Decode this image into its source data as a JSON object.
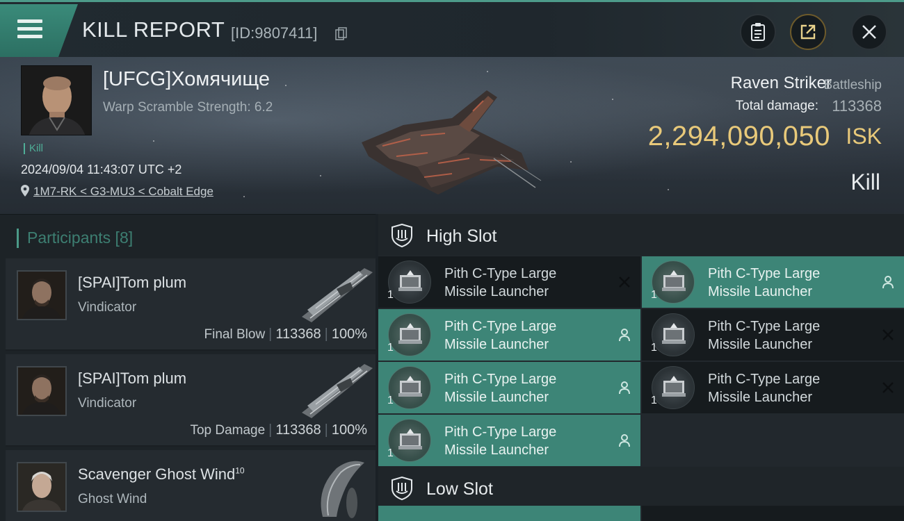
{
  "header": {
    "title": "KILL REPORT",
    "report_id": "[ID:9807411]"
  },
  "victim": {
    "name": "[UFCG]Хомячище",
    "scramble": "Warp Scramble Strength: 6.2",
    "kill_tag": "Kill",
    "datetime": "2024/09/04 11:43:07 UTC +2",
    "location": "1M7-RK < G3-MU3 < Cobalt Edge",
    "ship_name": "Raven Striker",
    "ship_class": "Battleship",
    "total_damage_label": "Total damage:",
    "total_damage": "113368",
    "isk_value": "2,294,090,050",
    "isk_unit": "ISK",
    "result": "Kill"
  },
  "participants": {
    "header": "Participants [8]",
    "items": [
      {
        "name": "[SPAI]Tom plum",
        "ship": "Vindicator",
        "label": "Final Blow",
        "damage": "113368",
        "percent": "100%"
      },
      {
        "name": "[SPAI]Tom plum",
        "ship": "Vindicator",
        "label": "Top Damage",
        "damage": "113368",
        "percent": "100%"
      },
      {
        "name": "Scavenger Ghost Wind",
        "name_sup": "10",
        "ship": "Ghost Wind"
      }
    ]
  },
  "slots": {
    "high_label": "High Slot",
    "low_label": "Low Slot",
    "modules": [
      {
        "line1": "Pith C-Type Large",
        "line2": "Missile Launcher",
        "qty": "1",
        "state": "destroyed",
        "teal": false
      },
      {
        "line1": "Pith C-Type Large",
        "line2": "Missile Launcher",
        "qty": "1",
        "state": "dropped",
        "teal": true
      },
      {
        "line1": "Pith C-Type Large",
        "line2": "Missile Launcher",
        "qty": "1",
        "state": "dropped",
        "teal": true
      },
      {
        "line1": "Pith C-Type Large",
        "line2": "Missile Launcher",
        "qty": "1",
        "state": "destroyed",
        "teal": false
      },
      {
        "line1": "Pith C-Type Large",
        "line2": "Missile Launcher",
        "qty": "1",
        "state": "dropped",
        "teal": true
      },
      {
        "line1": "Pith C-Type Large",
        "line2": "Missile Launcher",
        "qty": "1",
        "state": "destroyed",
        "teal": false
      },
      {
        "line1": "Pith C-Type Large",
        "line2": "Missile Launcher",
        "qty": "1",
        "state": "dropped",
        "teal": true
      }
    ]
  },
  "icons": {
    "menu": "menu-icon",
    "copy": "copy-icon",
    "clipboard": "clipboard-icon",
    "share": "share-icon",
    "close": "close-icon",
    "location": "location-pin-icon",
    "slot": "shield-slot-icon",
    "dropped": "person-icon",
    "destroyed": "x-icon"
  },
  "colors": {
    "accent_teal": "#3d8577",
    "isk_gold": "#e8c97a",
    "kill_green": "#4fae97"
  }
}
